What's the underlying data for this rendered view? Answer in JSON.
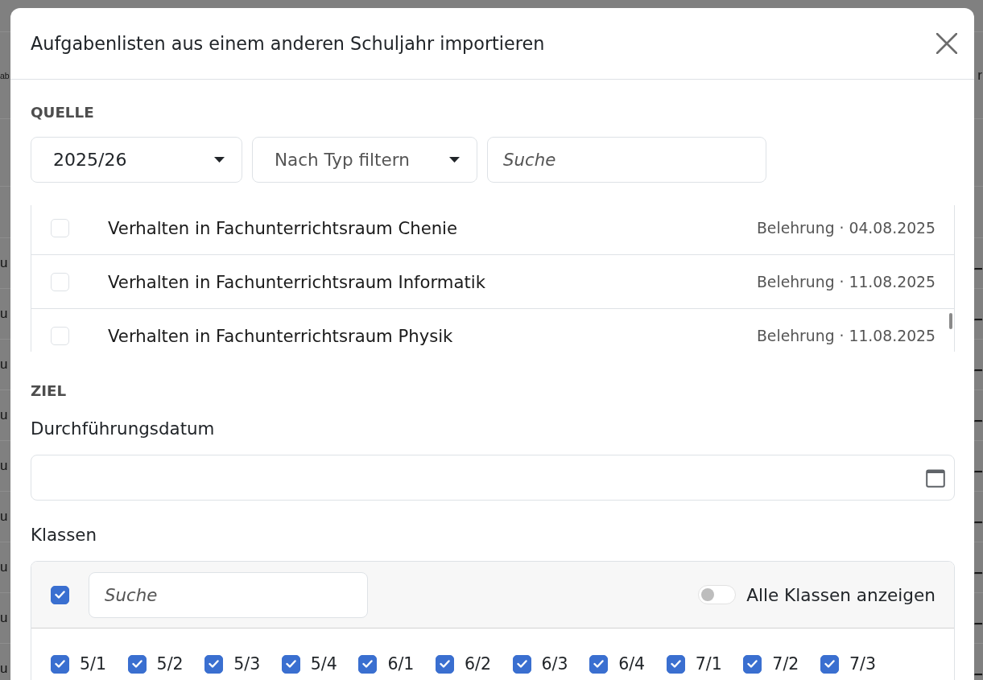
{
  "background_page": {
    "rows": [
      {
        "left_text": "ab",
        "right_text": "r"
      },
      {
        "left_text": "u",
        "right_text": "_"
      },
      {
        "left_text": "u",
        "right_text": "_"
      },
      {
        "left_text": "u",
        "right_text": "_"
      },
      {
        "left_text": "u",
        "right_text": "_"
      },
      {
        "left_text": "u",
        "right_text": "_"
      },
      {
        "left_text": "u",
        "right_text": "_"
      },
      {
        "left_text": "u",
        "right_text": "_"
      },
      {
        "left_text": "u",
        "right_text": "_"
      },
      {
        "left_text": "u",
        "right_text": "_"
      }
    ]
  },
  "dialog": {
    "title": "Aufgabenlisten aus einem anderen Schuljahr importieren"
  },
  "source": {
    "heading": "QUELLE",
    "school_year_select": {
      "value": "2025/26"
    },
    "type_filter_select": {
      "placeholder": "Nach Typ filtern"
    },
    "search": {
      "placeholder": "Suche"
    },
    "task_lists": [
      {
        "title": "Verhalten in Fachunterrichtsraum Chenie",
        "meta": "Belehrung · 04.08.2025",
        "checked": false
      },
      {
        "title": "Verhalten in Fachunterrichtsraum Informatik",
        "meta": "Belehrung · 11.08.2025",
        "checked": false
      },
      {
        "title": "Verhalten in Fachunterrichtsraum Physik",
        "meta": "Belehrung · 11.08.2025",
        "checked": false
      }
    ]
  },
  "target": {
    "heading": "ZIEL",
    "date_field": {
      "label": "Durchführungsdatum"
    },
    "classes": {
      "label": "Klassen",
      "select_all_checked": true,
      "search": {
        "placeholder": "Suche"
      },
      "show_all_toggle": {
        "label": "Alle Klassen anzeigen",
        "on": false
      },
      "items": [
        {
          "label": "5/1",
          "checked": true
        },
        {
          "label": "5/2",
          "checked": true
        },
        {
          "label": "5/3",
          "checked": true
        },
        {
          "label": "5/4",
          "checked": true
        },
        {
          "label": "6/1",
          "checked": true
        },
        {
          "label": "6/2",
          "checked": true
        },
        {
          "label": "6/3",
          "checked": true
        },
        {
          "label": "6/4",
          "checked": true
        },
        {
          "label": "7/1",
          "checked": true
        },
        {
          "label": "7/2",
          "checked": true
        },
        {
          "label": "7/3",
          "checked": true
        }
      ]
    }
  }
}
